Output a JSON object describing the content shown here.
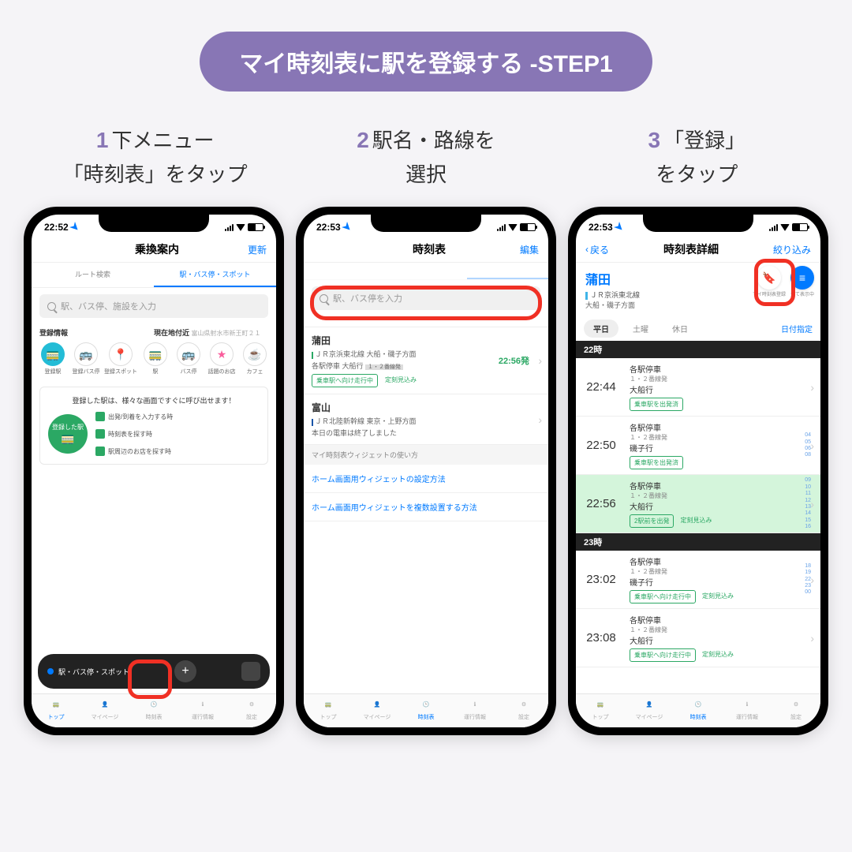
{
  "header_pill": "マイ時刻表に駅を登録する -STEP1",
  "steps": [
    {
      "num": "1",
      "line1": "下メニュー",
      "line2": "「時刻表」をタップ"
    },
    {
      "num": "2",
      "line1": "駅名・路線を",
      "line2": "選択"
    },
    {
      "num": "3",
      "line1": "「登録」",
      "line2": "をタップ"
    }
  ],
  "status": {
    "t1": "22:52",
    "t2": "22:53",
    "t3": "22:53"
  },
  "phone1": {
    "title": "乗換案内",
    "refresh": "更新",
    "tab_a": "ルート検索",
    "tab_b": "駅・バス停・スポット",
    "search_ph": "駅、バス停、施設を入力",
    "sec_a": "登録情報",
    "sec_b": "現在地付近",
    "sec_b_sub": "富山県射水市新王町２１",
    "icons": [
      {
        "label": "登録駅",
        "color": "#23bcd6"
      },
      {
        "label": "登録バス停",
        "color": "#ff9d3b"
      },
      {
        "label": "登録スポット",
        "color": "#ffcc33"
      },
      {
        "label": "駅",
        "color": "#23bcd6"
      },
      {
        "label": "バス停",
        "color": "#ff9d3b"
      },
      {
        "label": "話題のお店",
        "color": "#f95d9c"
      },
      {
        "label": "カフェ",
        "color": "#e8a84b"
      }
    ],
    "card_title": "登録した駅は、様々な画面ですぐに呼び出せます！",
    "card_center": "登録した駅",
    "diag": [
      "出発/到着を入力する時",
      "時刻表を探す時",
      "駅周辺のお店を探す時"
    ],
    "float": "駅・バス停・スポット"
  },
  "phone2": {
    "title": "時刻表",
    "edit": "編集",
    "search_ph": "駅、バス停を入力",
    "station1": {
      "name": "蒲田",
      "line": "ＪＲ京浜東北線 大船・磯子方面",
      "type": "各駅停車  大船行",
      "plat": "１・２番線発",
      "tag1": "乗車駅へ向け走行中",
      "tag2": "定刻見込み",
      "time": "22:56発"
    },
    "station2": {
      "name": "富山",
      "line": "ＪＲ北陸新幹線 東京・上野方面",
      "note": "本日の電車は終了しました"
    },
    "widget_header": "マイ時刻表ウィジェットの使い方",
    "link1": "ホーム画面用ウィジェットの設定方法",
    "link2": "ホーム画面用ウィジェットを複数設置する方法"
  },
  "phone3": {
    "back": "戻る",
    "title": "時刻表詳細",
    "load": "絞り込み",
    "station": "蒲田",
    "line": "ＪＲ京浜東北線",
    "dir": "大船・磯子方面",
    "reg_label": "マイ時刻表登録",
    "disp_label": "全て表示中",
    "days": {
      "wd": "平日",
      "sat": "土曜",
      "hol": "休日"
    },
    "date_pick": "日付指定",
    "h22": "22時",
    "h23": "23時",
    "trains22": [
      {
        "time": "22:44",
        "type": "各駅停車",
        "plat": "１・２番線発",
        "dest": "大船行",
        "tag1": "乗車駅を出発済",
        "hl": false
      },
      {
        "time": "22:50",
        "type": "各駅停車",
        "plat": "１・２番線発",
        "dest": "磯子行",
        "tag1": "乗車駅を出発済",
        "hl": false
      },
      {
        "time": "22:56",
        "type": "各駅停車",
        "plat": "１・２番線発",
        "dest": "大船行",
        "tag1": "2駅前を出発",
        "tag2": "定刻見込み",
        "hl": true
      }
    ],
    "trains23": [
      {
        "time": "23:02",
        "type": "各駅停車",
        "plat": "１・２番線発",
        "dest": "磯子行",
        "tag1": "乗車駅へ向け走行中",
        "tag2": "定刻見込み"
      },
      {
        "time": "23:08",
        "type": "各駅停車",
        "plat": "１・２番線発",
        "dest": "大船行",
        "tag1": "乗車駅へ向け走行中",
        "tag2": "定刻見込み"
      }
    ],
    "minutes1": [
      "04",
      "05",
      "06",
      "08"
    ],
    "minutes2": [
      "09",
      "10",
      "11",
      "12",
      "13",
      "14",
      "15",
      "16"
    ],
    "minutes3": [
      "18",
      "19",
      "22",
      "23",
      "00"
    ]
  },
  "nav": [
    {
      "label": "トップ",
      "icon": "train"
    },
    {
      "label": "マイページ",
      "icon": "person"
    },
    {
      "label": "時刻表",
      "icon": "clock"
    },
    {
      "label": "運行情報",
      "icon": "info"
    },
    {
      "label": "設定",
      "icon": "gear"
    }
  ]
}
